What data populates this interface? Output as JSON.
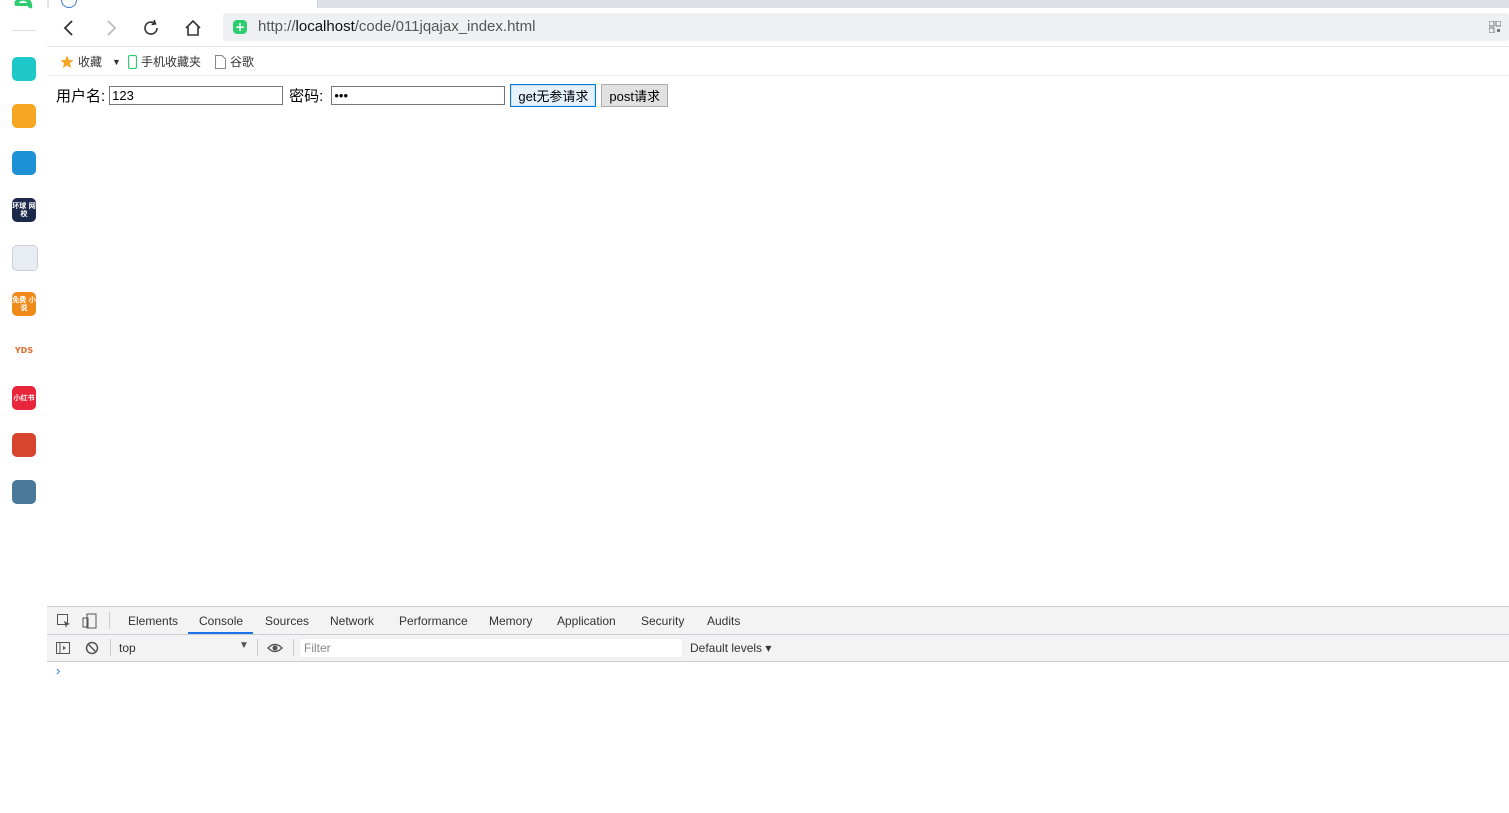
{
  "browser": {
    "url_prefix": "http://",
    "url_host": "localhost",
    "url_path": "/code/011jqajax_index.html"
  },
  "bookmarks": [
    {
      "label": "收藏",
      "icon": "star-icon"
    },
    {
      "label": "手机收藏夹",
      "icon": "phone-icon"
    },
    {
      "label": "谷歌",
      "icon": "page-icon"
    }
  ],
  "sidebar_apps": [
    {
      "name": "app-1",
      "color": "#1fc8c8",
      "text": ""
    },
    {
      "name": "app-2",
      "color": "#f5a623",
      "text": ""
    },
    {
      "name": "app-3",
      "color": "#1e90d6",
      "text": ""
    },
    {
      "name": "app-4",
      "color": "#1b2a4a",
      "text": "环球 网校"
    },
    {
      "name": "app-5",
      "color": "#e8edf3",
      "text": ""
    },
    {
      "name": "app-6",
      "color": "#f08b1a",
      "text": "免费 小说"
    },
    {
      "name": "app-7",
      "color": "#ffffff",
      "text": "YDS"
    },
    {
      "name": "app-8",
      "color": "#e8253a",
      "text": "小红书"
    },
    {
      "name": "app-9",
      "color": "#d8452f",
      "text": ""
    },
    {
      "name": "app-10",
      "color": "#4a7a9b",
      "text": ""
    }
  ],
  "form": {
    "username_label": "用户名:",
    "username_value": "123",
    "password_label": "密码:",
    "password_value": "•••",
    "get_button": "get无参请求",
    "post_button": "post请求"
  },
  "devtools": {
    "tabs": [
      "Elements",
      "Console",
      "Sources",
      "Network",
      "Performance",
      "Memory",
      "Application",
      "Security",
      "Audits"
    ],
    "active_tab": "Console",
    "context": "top",
    "filter_placeholder": "Filter",
    "levels": "Default levels ▾",
    "prompt": "›"
  },
  "colors": {
    "accent": "#1a73e8",
    "shield": "#2ecc71"
  }
}
